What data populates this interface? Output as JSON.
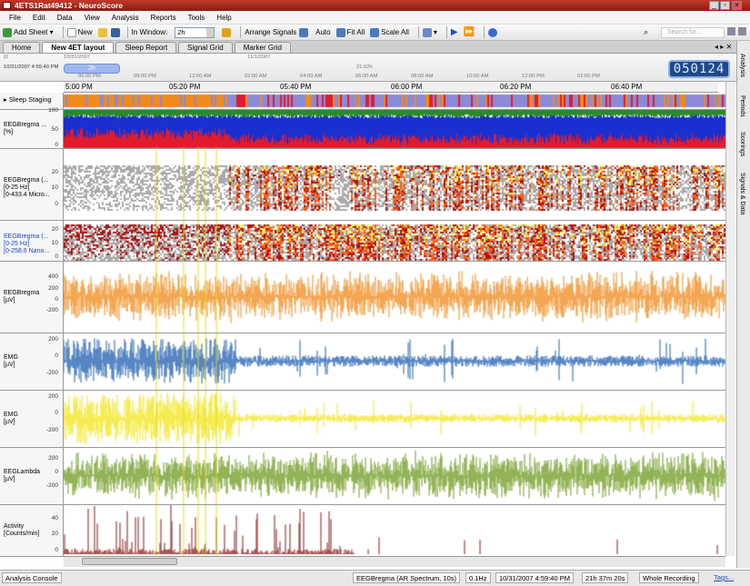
{
  "window": {
    "title": "4ETS1Rat49412 - NeuroScore"
  },
  "menu": [
    "File",
    "Edit",
    "Data",
    "View",
    "Analysis",
    "Reports",
    "Tools",
    "Help"
  ],
  "toolbar": {
    "add_sheet": "Add Sheet",
    "new": "New",
    "in_window": "In Window:",
    "window_value": "2h",
    "arrange": "Arrange Signals",
    "auto": "Auto",
    "fit_all": "Fit All",
    "scale_all": "Scale All",
    "search_placeholder": "Search for..."
  },
  "tabs": [
    "Home",
    "New 4ET layout",
    "Sleep Report",
    "Signal Grid",
    "Marker Grid"
  ],
  "active_tab": "New 4ET layout",
  "overview": {
    "start": "10/31/2007 4:59:40 PM",
    "date1": "10/31/2007",
    "date2": "11/1/2007",
    "handle": "2h",
    "span": "21.62h",
    "ticks": [
      "06:00 PM",
      "09:00 PM",
      "12:00 AM",
      "02:00 AM",
      "04:00 AM",
      "06:00 AM",
      "08:00 AM",
      "10:00 AM",
      "12:00 PM",
      "02:00 PM"
    ],
    "clock": "050124"
  },
  "time_axis": [
    "5:00 PM",
    "05:20 PM",
    "05:40 PM",
    "06:00 PM",
    "06:20 PM",
    "06:40 PM"
  ],
  "channels": [
    {
      "name": "Sleep Staging",
      "lines": []
    },
    {
      "lines": [
        "EEGBregma ...",
        "[%]"
      ],
      "ticks": [
        "100",
        "50",
        "0"
      ]
    },
    {
      "lines": [
        "EEGBregma (...",
        "[0-25 Hz]",
        "[0-433.4 Micro..."
      ],
      "ticks": [
        "20",
        "10",
        "0"
      ]
    },
    {
      "lines": [
        "EEGBregma (...",
        "[0-25 Hz]",
        "[0-258.6 Nano..."
      ],
      "ticks": [
        "20",
        "10",
        "0"
      ]
    },
    {
      "lines": [
        "EEGBregma",
        "[µV]"
      ],
      "ticks": [
        "400",
        "200",
        "0",
        "-200"
      ]
    },
    {
      "lines": [
        "EMG",
        "[µV]"
      ],
      "ticks": [
        "200",
        "0",
        "-200"
      ]
    },
    {
      "lines": [
        "EMG",
        "[µV]"
      ],
      "ticks": [
        "200",
        "0",
        "-200"
      ]
    },
    {
      "lines": [
        "EEGLambda",
        "[µV]"
      ],
      "ticks": [
        "200",
        "0",
        "-200"
      ]
    },
    {
      "lines": [
        "Activity",
        "[Counts/min]"
      ],
      "ticks": [
        "40",
        "20",
        "0"
      ]
    }
  ],
  "side_tabs": [
    "Analysis",
    "Periods",
    "Scorings",
    "Signals & Data"
  ],
  "status": {
    "console": "Analysis Console",
    "signal": "EEGBregma (AR Spectrum, 10s)",
    "freq": "0.1Hz",
    "datetime": "10/31/2007 4:59:40 PM",
    "duration": "21h 37m 20s",
    "range": "Whole Recording",
    "tags": "Tags..."
  },
  "colors": {
    "orange": "#f08a1a",
    "blue": "#1f5fb0",
    "yellow": "#f2e61a",
    "green": "#6f9a1f",
    "maroon": "#8a1a1a",
    "wake": "#f08a1a",
    "nrem": "#8a8ad8",
    "rem": "#e01c2c"
  }
}
